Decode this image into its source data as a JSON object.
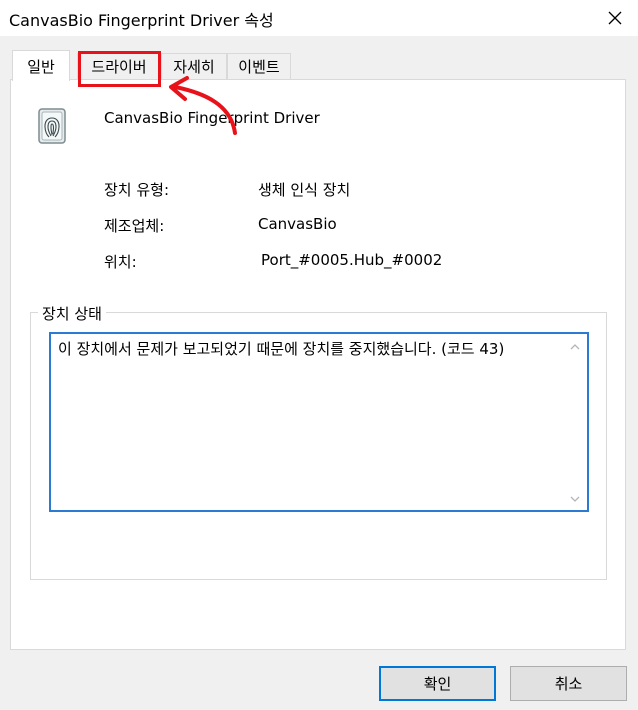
{
  "window": {
    "title": "CanvasBio Fingerprint Driver 속성",
    "close_icon": "close-icon"
  },
  "tabs": [
    {
      "label": "일반",
      "active": true
    },
    {
      "label": "드라이버",
      "active": false
    },
    {
      "label": "자세히",
      "active": false
    },
    {
      "label": "이벤트",
      "active": false
    }
  ],
  "device": {
    "icon": "fingerprint-icon",
    "name": "CanvasBio Fingerprint Driver"
  },
  "properties": [
    {
      "label": "장치 유형:",
      "value": "생체 인식 장치"
    },
    {
      "label": "제조업체:",
      "value": "CanvasBio"
    },
    {
      "label": "위치:",
      "value": "Port_#0005.Hub_#0002"
    }
  ],
  "status_group": {
    "legend": "장치 상태",
    "text": "이 장치에서 문제가 보고되었기 때문에 장치를 중지했습니다. (코드 43)"
  },
  "buttons": {
    "ok": "확인",
    "cancel": "취소"
  },
  "annotation": {
    "color": "#e8131a"
  }
}
